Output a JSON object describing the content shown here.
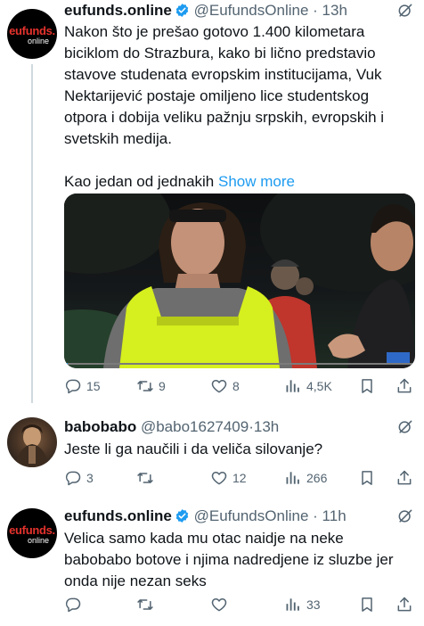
{
  "tweets": [
    {
      "name": "eufunds.online",
      "handle": "@EufundsOnline",
      "dot": "·",
      "time": "13h",
      "avatar_text": [
        "eufunds.",
        "online"
      ],
      "text_lines": [
        "Nakon što je prešao gotovo 1.400 kilometara",
        "biciklom do Strazbura, kako bi lično predstavio",
        "stavove studenata evropskim institucijama, Vuk",
        "Nektarijević postaje omiljeno lice studentskog",
        "otpora i dobija veliku pažnju srpskih, evropskih i",
        "svetskih medija."
      ],
      "text_tail": "Kao jedan od jednakih",
      "show_more": "Show more",
      "stats": {
        "replies": "15",
        "retweets": "9",
        "likes": "8",
        "views": "4,5K"
      }
    },
    {
      "name": "babobabo",
      "handle": "@babo1627409",
      "dot": "·",
      "time": "13h",
      "text_lines": [
        "Jeste li ga naučili i da veliča silovanje?"
      ],
      "stats": {
        "replies": "3",
        "retweets": "",
        "likes": "12",
        "views": "266"
      }
    },
    {
      "name": "eufunds.online",
      "handle": "@EufundsOnline",
      "dot": "·",
      "time": "11h",
      "avatar_text": [
        "eufunds.",
        "online"
      ],
      "text_lines": [
        "Velica samo kada mu otac naidje na neke",
        "babobabo botove i njima nadredjene iz sluzbe jer",
        "onda nije nezan seks"
      ],
      "stats": {
        "replies": "",
        "retweets": "",
        "likes": "",
        "views": "33"
      }
    }
  ],
  "icons": {
    "more": "grok-icon",
    "reply": "reply-icon",
    "retweet": "retweet-icon",
    "like": "heart-icon",
    "views": "views-icon",
    "bookmark": "bookmark-icon",
    "share": "share-icon"
  },
  "colors": {
    "link": "#1d9bf0",
    "muted": "#536471",
    "verified": "#1d9bf0",
    "brand_red": "#e5322d"
  }
}
